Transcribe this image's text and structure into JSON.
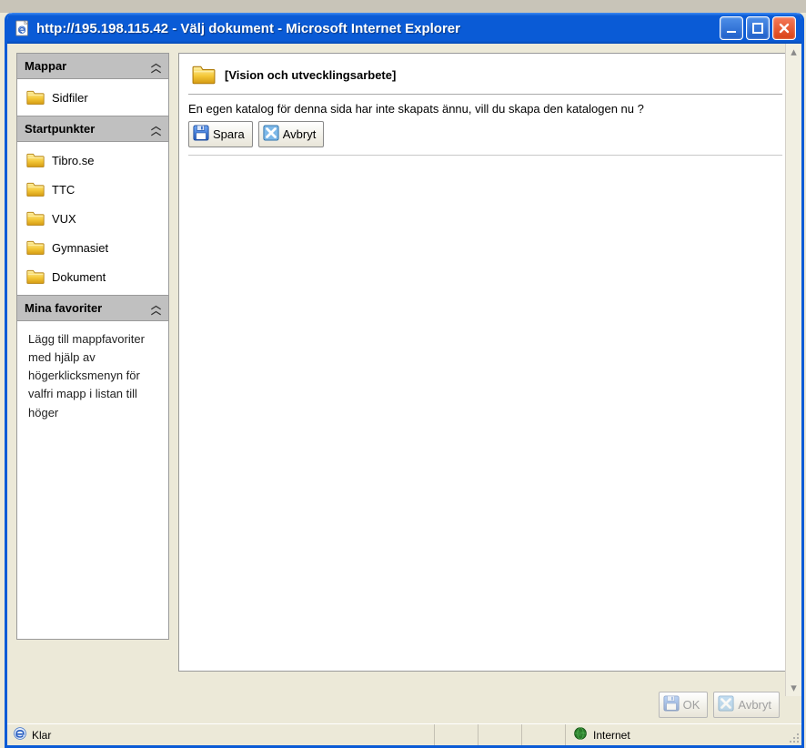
{
  "window": {
    "title": "http://195.198.115.42 - Välj dokument - Microsoft Internet Explorer"
  },
  "sidebar": {
    "sections": {
      "mappar": {
        "title": "Mappar",
        "items": [
          {
            "label": "Sidfiler"
          }
        ]
      },
      "startpunkter": {
        "title": "Startpunkter",
        "items": [
          {
            "label": "Tibro.se"
          },
          {
            "label": "TTC"
          },
          {
            "label": "VUX"
          },
          {
            "label": "Gymnasiet"
          },
          {
            "label": "Dokument"
          }
        ]
      },
      "favoriter": {
        "title": "Mina favoriter",
        "text": "Lägg till mappfavoriter med hjälp av högerklicksmenyn för valfri mapp i listan till höger"
      }
    }
  },
  "main": {
    "heading": "[Vision och utvecklingsarbete]",
    "prompt": "En egen katalog för denna sida har inte skapats ännu, vill du skapa den katalogen nu ?",
    "buttons": {
      "save": "Spara",
      "cancel": "Avbryt"
    }
  },
  "bottom": {
    "ok": "OK",
    "cancel": "Avbryt"
  },
  "statusbar": {
    "status": "Klar",
    "zone": "Internet"
  }
}
